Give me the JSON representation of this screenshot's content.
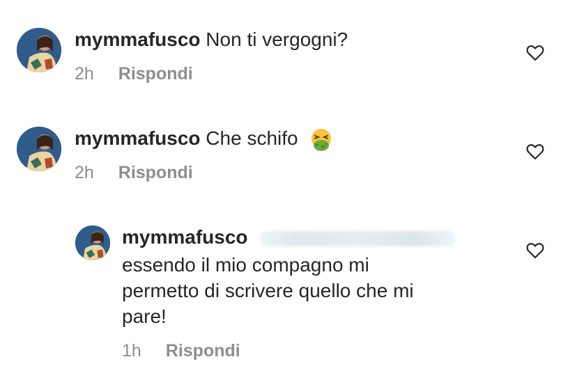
{
  "comments": [
    {
      "username": "mymmafusco",
      "text": "Non ti vergogni?",
      "time": "2h",
      "reply_label": "Rispondi"
    },
    {
      "username": "mymmafusco",
      "text": "Che schifo",
      "emoji": "nauseated-face",
      "time": "2h",
      "reply_label": "Rispondi"
    }
  ],
  "reply": {
    "username": "mymmafusco",
    "lines": [
      "essendo il mio compagno mi",
      "permetto di scrivere quello che mi",
      "pare!"
    ],
    "time": "1h",
    "reply_label": "Rispondi"
  },
  "colors": {
    "text": "#262626",
    "meta": "#8e8e8e",
    "background": "#ffffff"
  }
}
